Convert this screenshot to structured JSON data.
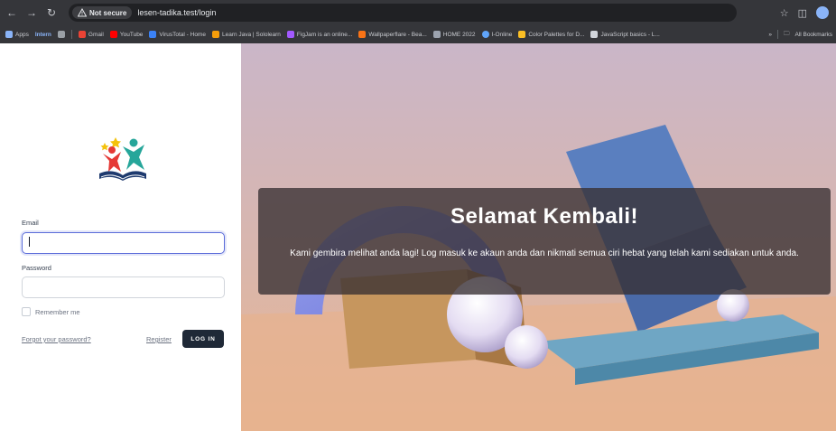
{
  "browser": {
    "security_label": "Not secure",
    "url": "lesen-tadika.test/login",
    "bookmarks": [
      {
        "label": "Apps",
        "color": "#8ab4f8"
      },
      {
        "label": "Intern",
        "color": "#8ab4f8"
      },
      {
        "label": "Gmail",
        "color": "#ea4335"
      },
      {
        "label": "YouTube",
        "color": "#ff0000"
      },
      {
        "label": "VirusTotal - Home",
        "color": "#3b82f6"
      },
      {
        "label": "Learn Java | Sololearn",
        "color": "#f59e0b"
      },
      {
        "label": "FigJam is an online...",
        "color": "#a259ff"
      },
      {
        "label": "Wallpaperflare - Bea...",
        "color": "#f97316"
      },
      {
        "label": "HOME 2022",
        "color": "#9ca3af"
      },
      {
        "label": "I-Online",
        "color": "#60a5fa"
      },
      {
        "label": "Color Palettes for D...",
        "color": "#fbbf24"
      },
      {
        "label": "JavaScript basics - L...",
        "color": "#d1d5db"
      }
    ],
    "all_bookmarks_label": "All Bookmarks"
  },
  "login": {
    "email_label": "Email",
    "email_value": "",
    "password_label": "Password",
    "password_value": "",
    "remember_label": "Remember me",
    "forgot_label": "Forgot your password?",
    "register_label": "Register",
    "login_button": "LOG IN"
  },
  "hero": {
    "title": "Selamat Kembali!",
    "subtitle": "Kami gembira melihat anda lagi! Log masuk ke akaun anda dan nikmati semua ciri hebat yang telah kami sediakan untuk anda."
  },
  "colors": {
    "chrome_bg": "#35363a",
    "button_bg": "#1f2937",
    "focus_border": "#5b6cd9",
    "overlay_bg": "rgba(55,48,50,0.78)"
  }
}
